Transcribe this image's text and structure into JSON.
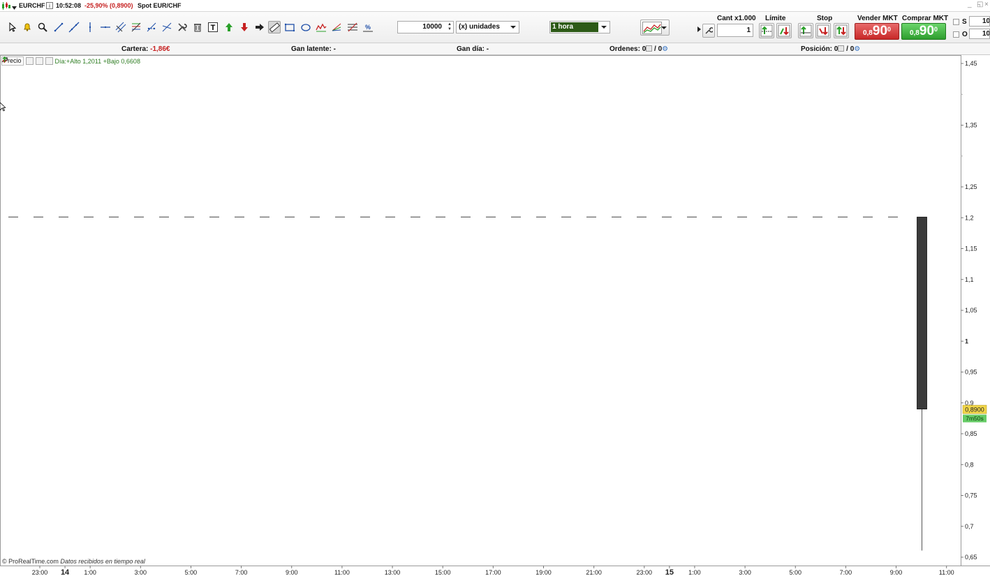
{
  "titlebar": {
    "symbol": "EURCHF",
    "time": "10:52:08",
    "change": "-25,90% (0,8900)",
    "instrument": "Spot EUR/CHF"
  },
  "toolbar": {
    "quantity_value": "10000",
    "units_label": "(x) unidades",
    "timeframe_label": "1 hora",
    "tools": [
      "cursor-icon",
      "alert-bell-icon",
      "zoom-icon",
      "segment-icon",
      "line-icon",
      "vertical-line-icon",
      "horizontal-line-icon",
      "channel-icon",
      "fibonacci-icon",
      "pitchfork-icon",
      "cross-line-icon",
      "settings-tools-icon",
      "trash-icon",
      "text-icon",
      "up-arrow-icon",
      "down-arrow-icon",
      "right-arrow-icon",
      "ruler-icon",
      "rectangle-icon",
      "ellipse-icon",
      "wave-icon",
      "fan-icon",
      "gann-icon",
      "percent-icon"
    ]
  },
  "trade_panel": {
    "qty_header": "Cant x1.000",
    "qty_value": "1",
    "limit_header": "Límite",
    "stop_header": "Stop",
    "sell_header": "Vender MKT",
    "buy_header": "Comprar MKT",
    "sell_price_small": "0,8",
    "sell_price_big": "90",
    "sell_price_sup": "0",
    "buy_price_small": "0,8",
    "buy_price_big": "90",
    "buy_price_sup": "0",
    "s_label": "S",
    "o_label": "O",
    "s_value": "10",
    "o_value": "10"
  },
  "infobar": {
    "cartera_label": "Cartera:",
    "cartera_value": "-1,86€",
    "gan_latente_label": "Gan latente:",
    "gan_latente_value": "-",
    "gan_dia_label": "Gan día:",
    "gan_dia_value": "-",
    "ordenes_label": "Ordenes:",
    "ordenes_value_a": "0",
    "ordenes_sep": "/",
    "ordenes_value_b": "0",
    "posicion_label": "Posición:",
    "posicion_value_a": "0",
    "posicion_sep": "/",
    "posicion_value_b": "0"
  },
  "chart": {
    "legend_label": "Precio",
    "day_stats": "Día:+Alto 1,2011 +Bajo 0,6608",
    "footer_brand": "© ProRealTime.com",
    "footer_note": "Datos recibidos en tiempo real"
  },
  "chart_data": {
    "type": "candlestick",
    "y_ticks": [
      "1,45",
      "1,35",
      "1,25",
      "1,2",
      "1,15",
      "1,1",
      "1,05",
      "1",
      "0,95",
      "0,9",
      "0,85",
      "0,8",
      "0,75",
      "0,7",
      "0,65"
    ],
    "y_bold_tick": "1",
    "ylim": [
      0.65,
      1.45
    ],
    "x_ticks": [
      {
        "label": "23:00"
      },
      {
        "label": "14",
        "bold": true
      },
      {
        "label": "1:00"
      },
      {
        "label": "3:00"
      },
      {
        "label": "5:00"
      },
      {
        "label": "7:00"
      },
      {
        "label": "9:00"
      },
      {
        "label": "11:00"
      },
      {
        "label": "13:00"
      },
      {
        "label": "15:00"
      },
      {
        "label": "17:00"
      },
      {
        "label": "19:00"
      },
      {
        "label": "21:00"
      },
      {
        "label": "23:00"
      },
      {
        "label": "15",
        "bold": true
      },
      {
        "label": "1:00"
      },
      {
        "label": "3:00"
      },
      {
        "label": "5:00"
      },
      {
        "label": "7:00"
      },
      {
        "label": "9:00"
      },
      {
        "label": "11:00"
      }
    ],
    "candles": [
      {
        "open": 1.2011,
        "high": 1.2011,
        "low": 0.6608,
        "close": 0.89,
        "color": "#3a3a3a"
      }
    ],
    "reference_line": {
      "value": 1.2011,
      "style": "dashed",
      "color": "#666666"
    },
    "last_price_label": "0,8900",
    "last_price_value": 0.89,
    "countdown_label": "7m50s",
    "last_price_color": "#f1d64a",
    "countdown_color": "#66cc66"
  }
}
